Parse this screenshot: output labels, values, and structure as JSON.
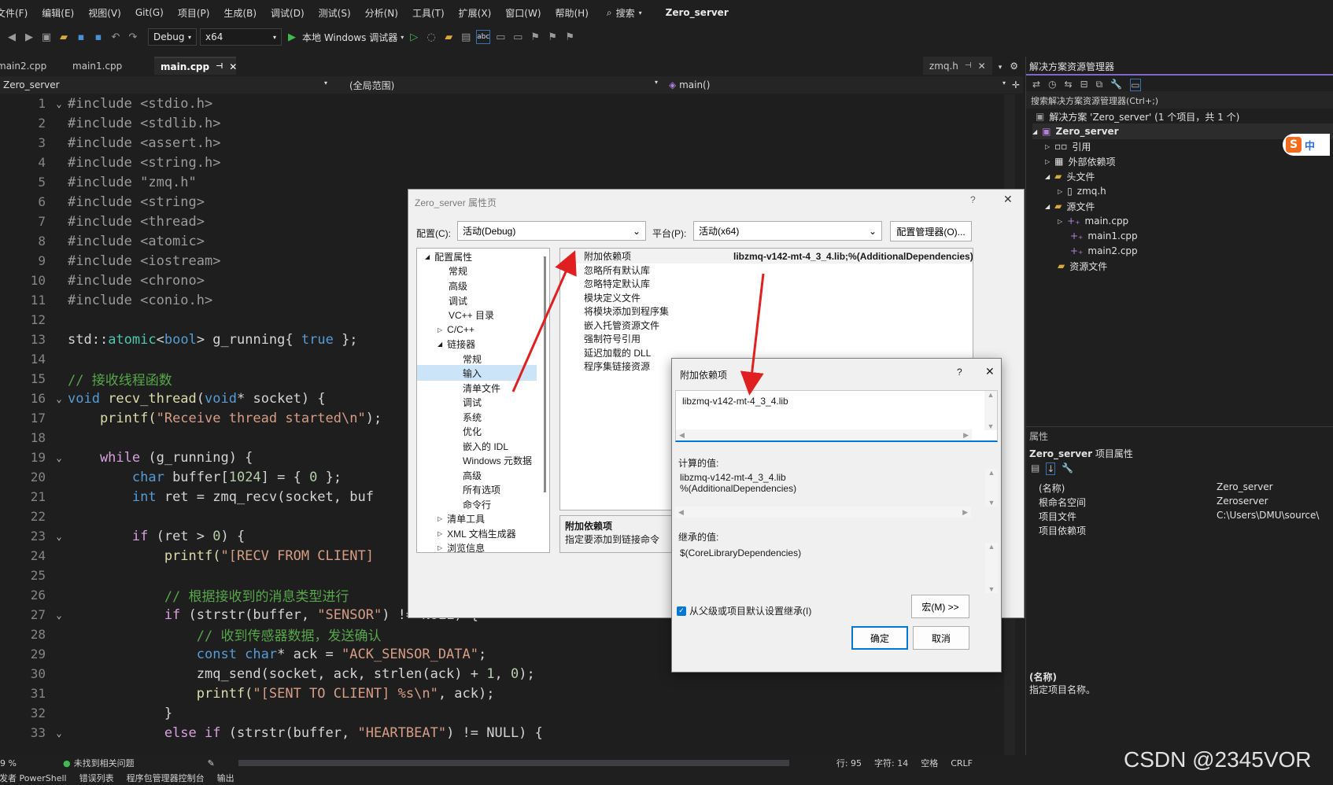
{
  "menu": {
    "items": [
      "文件(F)",
      "编辑(E)",
      "视图(V)",
      "Git(G)",
      "项目(P)",
      "生成(B)",
      "调试(D)",
      "测试(S)",
      "分析(N)",
      "工具(T)",
      "扩展(X)",
      "窗口(W)",
      "帮助(H)"
    ],
    "search": "搜索",
    "solution_name": "Zero_server"
  },
  "toolbar": {
    "config": "Debug",
    "platform": "x64",
    "run_label": "本地 Windows 调试器"
  },
  "tabs": {
    "items": [
      {
        "label": "main2.cpp"
      },
      {
        "label": "main1.cpp"
      },
      {
        "label": "main.cpp"
      }
    ],
    "right_tab": "zmq.h"
  },
  "navbar": {
    "project": "Zero_server",
    "scope": "(全局范围)",
    "member": "main()"
  },
  "code": {
    "line_numbers": [
      "1",
      "2",
      "3",
      "4",
      "5",
      "6",
      "7",
      "8",
      "9",
      "10",
      "11",
      "12",
      "13",
      "14",
      "15",
      "16",
      "17",
      "18",
      "19",
      "20",
      "21",
      "22",
      "23",
      "24",
      "25",
      "26",
      "27",
      "28",
      "29",
      "30",
      "31",
      "32",
      "33"
    ],
    "l1": "#include <stdio.h>",
    "l2": "#include <stdlib.h>",
    "l3": "#include <assert.h>",
    "l4": "#include <string.h>",
    "l5": "#include \"zmq.h\"",
    "l6": "#include <string>",
    "l7": "#include <thread>",
    "l8": "#include <atomic>",
    "l9": "#include <iostream>",
    "l10": "#include <chrono>",
    "l11": "#include <conio.h>",
    "l13a": "std::",
    "l13b": "atomic",
    "l13c": "<",
    "l13d": "bool",
    "l13e": "> g_running{ ",
    "l13f": "true",
    "l13g": " };",
    "l15": "// 接收线程函数",
    "l16a": "void ",
    "l16b": "recv_thread",
    "l16c": "(",
    "l16d": "void",
    "l16e": "* socket) {",
    "l17a": "    printf(",
    "l17b": "\"Receive thread started\\n\"",
    "l17c": ");",
    "l19a": "    while",
    "l19b": " (g_running) {",
    "l20a": "        char",
    "l20b": " buffer[",
    "l20c": "1024",
    "l20d": "] = { ",
    "l20e": "0",
    "l20f": " };",
    "l21a": "        int",
    "l21b": " ret = zmq_recv(socket, buf",
    "l23a": "        if",
    "l23b": " (ret > ",
    "l23c": "0",
    "l23d": ") {",
    "l24a": "            printf(",
    "l24b": "\"[RECV FROM CLIENT]",
    "l26": "            // 根据接收到的消息类型进行",
    "l27a": "            if",
    "l27b": " (strstr(buffer, ",
    "l27c": "\"SENSOR\"",
    "l27d": ") != NULL) {",
    "l28": "                // 收到传感器数据，发送确认",
    "l29a": "                const char",
    "l29b": "* ack = ",
    "l29c": "\"ACK_SENSOR_DATA\"",
    "l29d": ";",
    "l30a": "                zmq_send(socket, ack, strlen(ack) + ",
    "l30b": "1",
    "l30c": ", ",
    "l30d": "0",
    "l30e": ");",
    "l31a": "                printf(",
    "l31b": "\"[SENT TO CLIENT] %s\\n\"",
    "l31c": ", ack);",
    "l32": "            }",
    "l33a": "            else if",
    "l33b": " (strstr(buffer, ",
    "l33c": "\"HEARTBEAT\"",
    "l33d": ") != NULL) {"
  },
  "status": {
    "zoom": "9 %",
    "issues": "未找到相关问题",
    "line": "行: 95",
    "char": "字符: 14",
    "space": "空格",
    "eol": "CRLF"
  },
  "bottom_tabs": [
    "开发者 PowerShell",
    "错误列表",
    "程序包管理器控制台",
    "输出"
  ],
  "solution_explorer": {
    "title": "解决方案资源管理器",
    "search_placeholder": "搜索解决方案资源管理器(Ctrl+;)",
    "solution_label": "解决方案 'Zero_server' (1 个项目，共 1 个)",
    "project": "Zero_server",
    "nodes": {
      "refs": "引用",
      "ext": "外部依赖项",
      "headers": "头文件",
      "zmq": "zmq.h",
      "sources": "源文件",
      "main": "main.cpp",
      "main1": "main1.cpp",
      "main2": "main2.cpp",
      "res": "资源文件"
    },
    "badge": "中"
  },
  "properties_panel": {
    "title": "属性",
    "subject": "Zero_server",
    "subject_suffix": "项目属性",
    "rows": [
      {
        "name": "(名称)",
        "value": "Zero_server"
      },
      {
        "name": "根命名空间",
        "value": "Zeroserver"
      },
      {
        "name": "项目文件",
        "value": "C:\\Users\\DMU\\source\\"
      },
      {
        "name": "项目依赖项",
        "value": ""
      }
    ],
    "desc_title": "(名称)",
    "desc_text": "指定项目名称。"
  },
  "property_dialog": {
    "title": "Zero_server 属性页",
    "config_label": "配置(C):",
    "config_value": "活动(Debug)",
    "platform_label": "平台(P):",
    "platform_value": "活动(x64)",
    "config_manager": "配置管理器(O)...",
    "tree": {
      "root": "配置属性",
      "general": "常规",
      "advanced": "高级",
      "debugging": "调试",
      "vcdirs": "VC++ 目录",
      "cpp": "C/C++",
      "linker": "链接器",
      "l_general": "常规",
      "l_input": "输入",
      "l_manifest": "清单文件",
      "l_debug": "调试",
      "l_system": "系统",
      "l_opt": "优化",
      "l_idl": "嵌入的 IDL",
      "l_winmd": "Windows 元数据",
      "l_adv": "高级",
      "l_all": "所有选项",
      "l_cmd": "命令行",
      "manifest_tool": "清单工具",
      "xml": "XML 文档生成器",
      "browse": "浏览信息"
    },
    "props": [
      {
        "name": "附加依赖项",
        "value": "libzmq-v142-mt-4_3_4.lib;%(AdditionalDependencies)"
      },
      {
        "name": "忽略所有默认库",
        "value": ""
      },
      {
        "name": "忽略特定默认库",
        "value": ""
      },
      {
        "name": "模块定义文件",
        "value": ""
      },
      {
        "name": "将模块添加到程序集",
        "value": ""
      },
      {
        "name": "嵌入托管资源文件",
        "value": ""
      },
      {
        "name": "强制符号引用",
        "value": ""
      },
      {
        "name": "延迟加载的 DLL",
        "value": ""
      },
      {
        "name": "程序集链接资源",
        "value": ""
      }
    ],
    "desc_title": "附加依赖项",
    "desc_text": "指定要添加到链接命令"
  },
  "dep_dialog": {
    "title": "附加依赖项",
    "input_value": "libzmq-v142-mt-4_3_4.lib",
    "computed_label": "计算的值:",
    "computed_line1": "libzmq-v142-mt-4_3_4.lib",
    "computed_line2": "%(AdditionalDependencies)",
    "inherited_label": "继承的值:",
    "inherited_value": "$(CoreLibraryDependencies)",
    "inherit_checkbox": "从父级或项目默认设置继承(I)",
    "macro_button": "宏(M) >>",
    "ok_button": "确定",
    "cancel_button": "取消"
  },
  "watermark": "CSDN @2345VOR",
  "colors": {
    "accent": "#0078d4",
    "annotation": "#e02020"
  }
}
